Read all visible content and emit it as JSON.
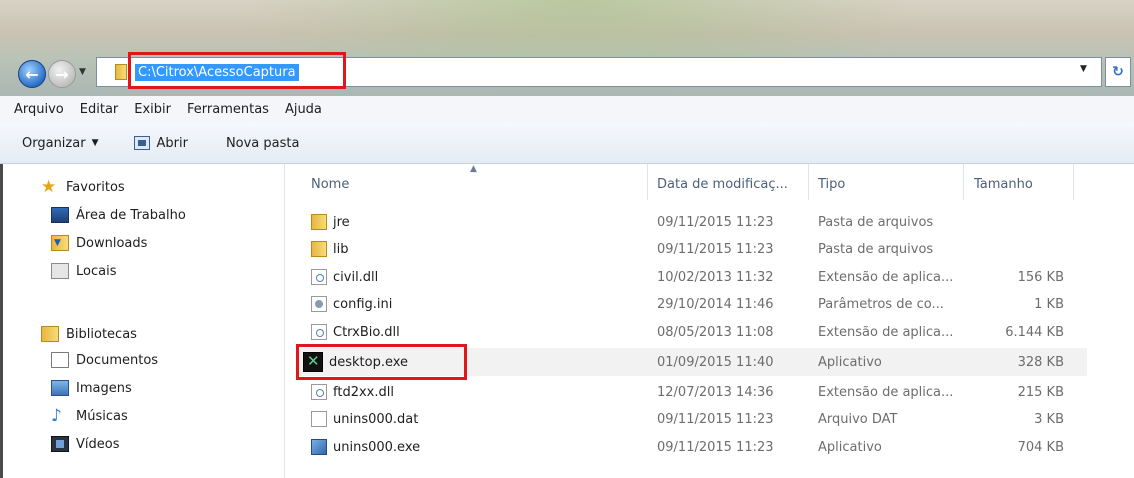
{
  "address_bar": {
    "path": "C:\\Citrox\\AcessoCaptura"
  },
  "menu": [
    "Arquivo",
    "Editar",
    "Exibir",
    "Ferramentas",
    "Ajuda"
  ],
  "toolbar": {
    "organize_label": "Organizar",
    "open_label": "Abrir",
    "new_folder_label": "Nova pasta"
  },
  "sidebar": {
    "favorites": "Favoritos",
    "fav_items": [
      "Área de Trabalho",
      "Downloads",
      "Locais"
    ],
    "libraries": "Bibliotecas",
    "lib_items": [
      "Documentos",
      "Imagens",
      "Músicas",
      "Vídeos"
    ]
  },
  "columns": {
    "name": "Nome",
    "date": "Data de modificaç...",
    "type": "Tipo",
    "size": "Tamanho"
  },
  "files": [
    {
      "name": "jre",
      "date": "09/11/2015 11:23",
      "type": "Pasta de arquivos",
      "size": "",
      "icon": "folder-icon"
    },
    {
      "name": "lib",
      "date": "09/11/2015 11:23",
      "type": "Pasta de arquivos",
      "size": "",
      "icon": "folder-icon"
    },
    {
      "name": "civil.dll",
      "date": "10/02/2013 11:32",
      "type": "Extensão de aplica...",
      "size": "156 KB",
      "icon": "dll-icon"
    },
    {
      "name": "config.ini",
      "date": "29/10/2014 11:46",
      "type": "Parâmetros de co...",
      "size": "1 KB",
      "icon": "ini-icon"
    },
    {
      "name": "CtrxBio.dll",
      "date": "08/05/2013 11:08",
      "type": "Extensão de aplica...",
      "size": "6.144 KB",
      "icon": "dll-icon"
    },
    {
      "name": "desktop.exe",
      "date": "01/09/2015 11:40",
      "type": "Aplicativo",
      "size": "328 KB",
      "icon": "exe-icon"
    },
    {
      "name": "ftd2xx.dll",
      "date": "12/07/2013 14:36",
      "type": "Extensão de aplica...",
      "size": "215 KB",
      "icon": "dll-icon"
    },
    {
      "name": "unins000.dat",
      "date": "09/11/2015 11:23",
      "type": "Arquivo DAT",
      "size": "3 KB",
      "icon": "dat-icon"
    },
    {
      "name": "unins000.exe",
      "date": "09/11/2015 11:23",
      "type": "Aplicativo",
      "size": "704 KB",
      "icon": "setup-icon"
    }
  ],
  "colors": {
    "highlight_red": "#e0161b",
    "selection_blue": "#3399ff"
  }
}
